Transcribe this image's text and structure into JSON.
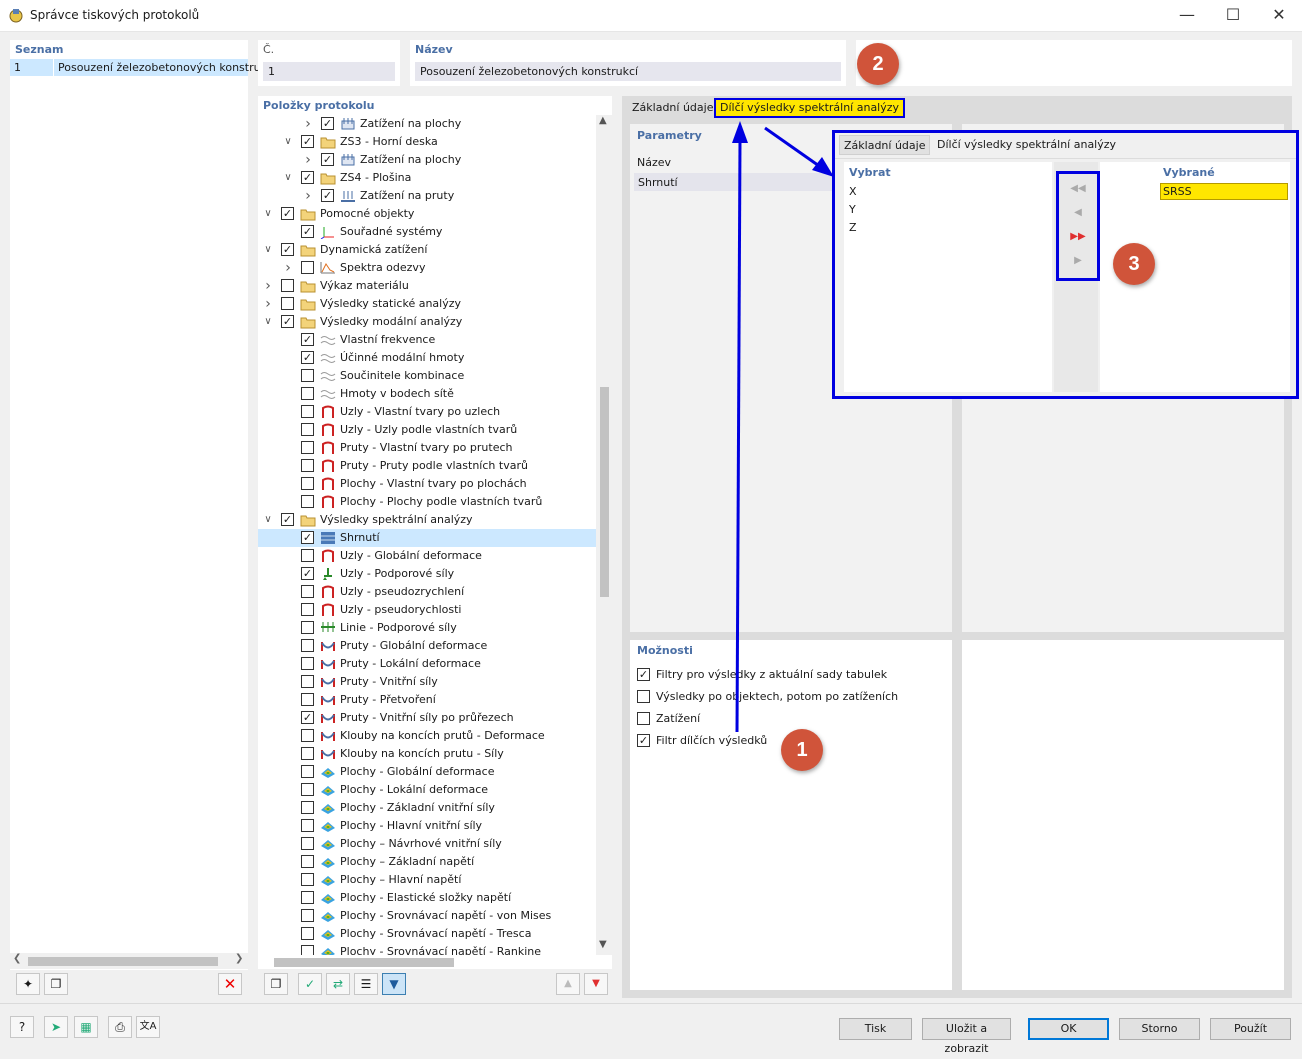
{
  "window": {
    "title": "Správce tiskových protokolů",
    "minimize_icon": "minimize-icon",
    "maximize_icon": "maximize-icon",
    "close_icon": "close-icon"
  },
  "list_panel": {
    "header": "Seznam",
    "rows": [
      {
        "num": "1",
        "name": "Posouzení železobetonových konstru"
      }
    ]
  },
  "number_field": {
    "label": "Č.",
    "value": "1"
  },
  "name_field": {
    "label": "Název",
    "value": "Posouzení železobetonových konstrukcí"
  },
  "protocol_items": {
    "header": "Položky protokolu",
    "rows": [
      {
        "indent": 2,
        "chev": "right",
        "checked": true,
        "icon": "surface-load-icon",
        "label": "Zatížení na plochy"
      },
      {
        "indent": 1,
        "chev": "down",
        "checked": true,
        "icon": "folder-icon",
        "label": "ZS3 - Horní deska"
      },
      {
        "indent": 2,
        "chev": "right",
        "checked": true,
        "icon": "surface-load-icon",
        "label": "Zatížení na plochy"
      },
      {
        "indent": 1,
        "chev": "down",
        "checked": true,
        "icon": "folder-icon",
        "label": "ZS4 - Plošina"
      },
      {
        "indent": 2,
        "chev": "right",
        "checked": true,
        "icon": "member-load-icon",
        "label": "Zatížení na pruty"
      },
      {
        "indent": 0,
        "chev": "down",
        "checked": true,
        "icon": "folder-icon",
        "label": "Pomocné objekty"
      },
      {
        "indent": 1,
        "chev": "",
        "checked": true,
        "icon": "coordinate-system-icon",
        "label": "Souřadné systémy"
      },
      {
        "indent": 0,
        "chev": "down",
        "checked": true,
        "icon": "folder-icon",
        "label": "Dynamická zatížení"
      },
      {
        "indent": 1,
        "chev": "right",
        "checked": false,
        "icon": "spectrum-icon",
        "label": "Spektra odezvy"
      },
      {
        "indent": 0,
        "chev": "right",
        "checked": false,
        "icon": "folder-icon",
        "label": "Výkaz materiálu"
      },
      {
        "indent": 0,
        "chev": "right",
        "checked": false,
        "icon": "folder-icon",
        "label": "Výsledky statické analýzy"
      },
      {
        "indent": 0,
        "chev": "down",
        "checked": true,
        "icon": "folder-icon",
        "label": "Výsledky modální analýzy"
      },
      {
        "indent": 1,
        "chev": "",
        "checked": true,
        "icon": "wave-icon",
        "label": "Vlastní frekvence"
      },
      {
        "indent": 1,
        "chev": "",
        "checked": true,
        "icon": "wave-icon",
        "label": "Účinné modální hmoty"
      },
      {
        "indent": 1,
        "chev": "",
        "checked": false,
        "icon": "wave-icon",
        "label": "Součinitele kombinace"
      },
      {
        "indent": 1,
        "chev": "",
        "checked": false,
        "icon": "wave-icon",
        "label": "Hmoty v bodech sítě"
      },
      {
        "indent": 1,
        "chev": "",
        "checked": false,
        "icon": "mode-shape-icon",
        "label": "Uzly - Vlastní tvary po uzlech"
      },
      {
        "indent": 1,
        "chev": "",
        "checked": false,
        "icon": "mode-shape-icon",
        "label": "Uzly - Uzly podle vlastních tvarů"
      },
      {
        "indent": 1,
        "chev": "",
        "checked": false,
        "icon": "mode-shape-icon",
        "label": "Pruty - Vlastní tvary po prutech"
      },
      {
        "indent": 1,
        "chev": "",
        "checked": false,
        "icon": "mode-shape-icon",
        "label": "Pruty - Pruty podle vlastních tvarů"
      },
      {
        "indent": 1,
        "chev": "",
        "checked": false,
        "icon": "mode-shape-icon",
        "label": "Plochy - Vlastní tvary po plochách"
      },
      {
        "indent": 1,
        "chev": "",
        "checked": false,
        "icon": "mode-shape-icon",
        "label": "Plochy - Plochy podle vlastních tvarů"
      },
      {
        "indent": 0,
        "chev": "down",
        "checked": true,
        "icon": "folder-icon",
        "label": "Výsledky spektrální analýzy"
      },
      {
        "indent": 1,
        "chev": "",
        "checked": true,
        "icon": "summary-table-icon",
        "label": "Shrnutí",
        "selected": true
      },
      {
        "indent": 1,
        "chev": "",
        "checked": false,
        "icon": "mode-shape-icon",
        "label": "Uzly - Globální deformace"
      },
      {
        "indent": 1,
        "chev": "",
        "checked": true,
        "icon": "support-force-icon",
        "label": "Uzly - Podporové síly"
      },
      {
        "indent": 1,
        "chev": "",
        "checked": false,
        "icon": "mode-shape-icon",
        "label": "Uzly - pseudozrychlení"
      },
      {
        "indent": 1,
        "chev": "",
        "checked": false,
        "icon": "mode-shape-icon",
        "label": "Uzly - pseudorychlosti"
      },
      {
        "indent": 1,
        "chev": "",
        "checked": false,
        "icon": "line-support-icon",
        "label": "Linie - Podporové síly"
      },
      {
        "indent": 1,
        "chev": "",
        "checked": false,
        "icon": "member-result-icon",
        "label": "Pruty - Globální deformace"
      },
      {
        "indent": 1,
        "chev": "",
        "checked": false,
        "icon": "member-result-icon",
        "label": "Pruty - Lokální deformace"
      },
      {
        "indent": 1,
        "chev": "",
        "checked": false,
        "icon": "member-result-icon",
        "label": "Pruty - Vnitřní síly"
      },
      {
        "indent": 1,
        "chev": "",
        "checked": false,
        "icon": "member-result-icon",
        "label": "Pruty - Přetvoření"
      },
      {
        "indent": 1,
        "chev": "",
        "checked": true,
        "icon": "member-result-icon",
        "label": "Pruty - Vnitřní síly po průřezech"
      },
      {
        "indent": 1,
        "chev": "",
        "checked": false,
        "icon": "member-result-icon",
        "label": "Klouby na koncích prutů - Deformace"
      },
      {
        "indent": 1,
        "chev": "",
        "checked": false,
        "icon": "member-result-icon",
        "label": "Klouby na koncích prutu - Síly"
      },
      {
        "indent": 1,
        "chev": "",
        "checked": false,
        "icon": "surface-result-icon",
        "label": "Plochy - Globální deformace"
      },
      {
        "indent": 1,
        "chev": "",
        "checked": false,
        "icon": "surface-result-icon",
        "label": "Plochy - Lokální deformace"
      },
      {
        "indent": 1,
        "chev": "",
        "checked": false,
        "icon": "surface-result-icon",
        "label": "Plochy - Základní vnitřní síly"
      },
      {
        "indent": 1,
        "chev": "",
        "checked": false,
        "icon": "surface-result-icon",
        "label": "Plochy - Hlavní vnitřní síly"
      },
      {
        "indent": 1,
        "chev": "",
        "checked": false,
        "icon": "surface-result-icon",
        "label": "Plochy – Návrhové vnitřní síly"
      },
      {
        "indent": 1,
        "chev": "",
        "checked": false,
        "icon": "surface-result-icon",
        "label": "Plochy – Základní napětí"
      },
      {
        "indent": 1,
        "chev": "",
        "checked": false,
        "icon": "surface-result-icon",
        "label": "Plochy – Hlavní napětí"
      },
      {
        "indent": 1,
        "chev": "",
        "checked": false,
        "icon": "surface-result-icon",
        "label": "Plochy - Elastické složky napětí"
      },
      {
        "indent": 1,
        "chev": "",
        "checked": false,
        "icon": "surface-result-icon",
        "label": "Plochy - Srovnávací napětí - von Mises"
      },
      {
        "indent": 1,
        "chev": "",
        "checked": false,
        "icon": "surface-result-icon",
        "label": "Plochy - Srovnávací napětí - Tresca"
      },
      {
        "indent": 1,
        "chev": "",
        "checked": false,
        "icon": "surface-result-icon",
        "label": "Plochy - Srovnávací napětí - Rankine"
      }
    ]
  },
  "right_tabs": {
    "tab1": "Základní údaje",
    "tab2": "Dílčí výsledky spektrální analýzy"
  },
  "parameters": {
    "header": "Parametry",
    "name_label": "Název",
    "row": "Shrnutí"
  },
  "options": {
    "header": "Možnosti",
    "items": [
      {
        "label": "Filtry pro výsledky z aktuální sady tabulek",
        "checked": true
      },
      {
        "label": "Výsledky po objektech, potom po zatíženích",
        "checked": false
      },
      {
        "label": "Zatížení",
        "checked": false
      },
      {
        "label": "Filtr dílčích výsledků",
        "checked": true
      }
    ]
  },
  "inset": {
    "tab1": "Základní údaje",
    "tab2": "Dílčí výsledky spektrální analýzy",
    "select_header": "Vybrat",
    "selected_header": "Vybrané",
    "available": [
      "X",
      "Y",
      "Z"
    ],
    "chosen": [
      "SRSS"
    ],
    "buttons": [
      "move-all-left-icon",
      "move-left-icon",
      "move-all-right-icon",
      "move-right-icon"
    ]
  },
  "badges": {
    "b1": "1",
    "b2": "2",
    "b3": "3"
  },
  "footer": {
    "print": "Tisk",
    "save_show": "Uložit a zobrazit",
    "ok": "OK",
    "cancel": "Storno",
    "apply": "Použít"
  },
  "colors": {
    "accent_blue": "#0000e0",
    "highlight_yellow": "#ffe600",
    "badge_red": "#d0543a",
    "header_blue": "#4a6fa5"
  }
}
